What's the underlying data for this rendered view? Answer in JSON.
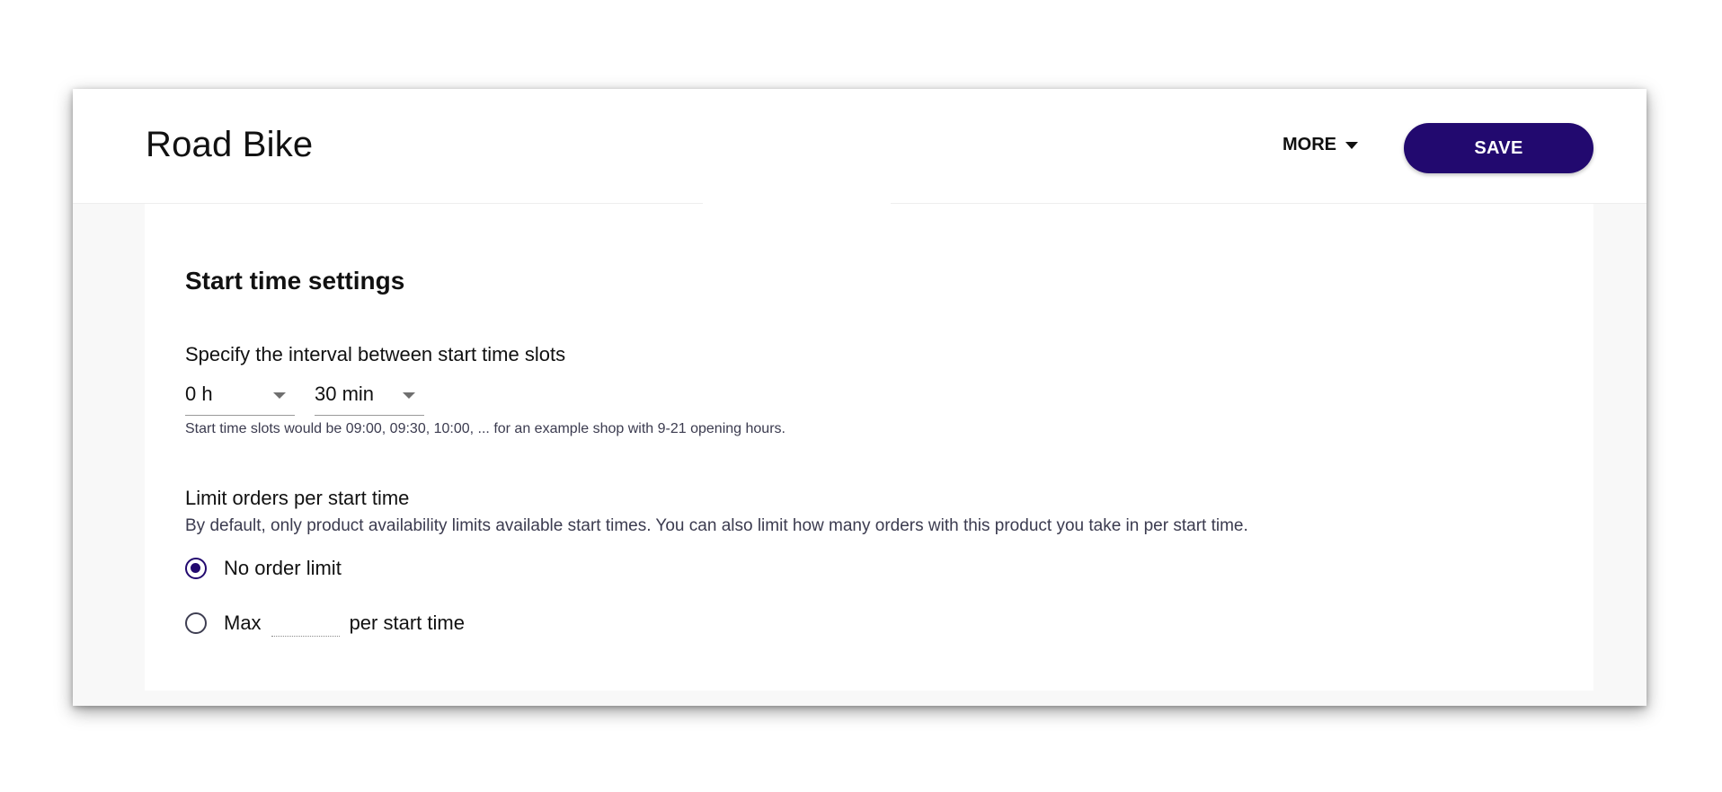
{
  "header": {
    "title": "Road Bike",
    "more_label": "MORE",
    "save_label": "SAVE"
  },
  "start_time_settings": {
    "section_title": "Start time settings",
    "interval": {
      "label": "Specify the interval between start time slots",
      "hours_value": "0 h",
      "minutes_value": "30 min",
      "hint": "Start time slots would be 09:00, 09:30, 10:00, ... for an example shop with 9-21 opening hours."
    },
    "limit": {
      "title": "Limit orders per start time",
      "description": "By default, only product availability limits available start times. You can also limit how many orders with this product you take in per start time.",
      "options": [
        {
          "label": "No order limit",
          "checked": true
        },
        {
          "label_before": "Max",
          "label_after": "per start time",
          "input_value": "",
          "checked": false
        }
      ]
    }
  },
  "icons": {
    "more_caret": "caret-down-icon",
    "select_caret": "chevron-down-icon"
  },
  "colors": {
    "accent": "#22096f",
    "page_background": "#f8f8f8",
    "card_background": "#ffffff",
    "secondary_text": "#3b3b4f"
  }
}
